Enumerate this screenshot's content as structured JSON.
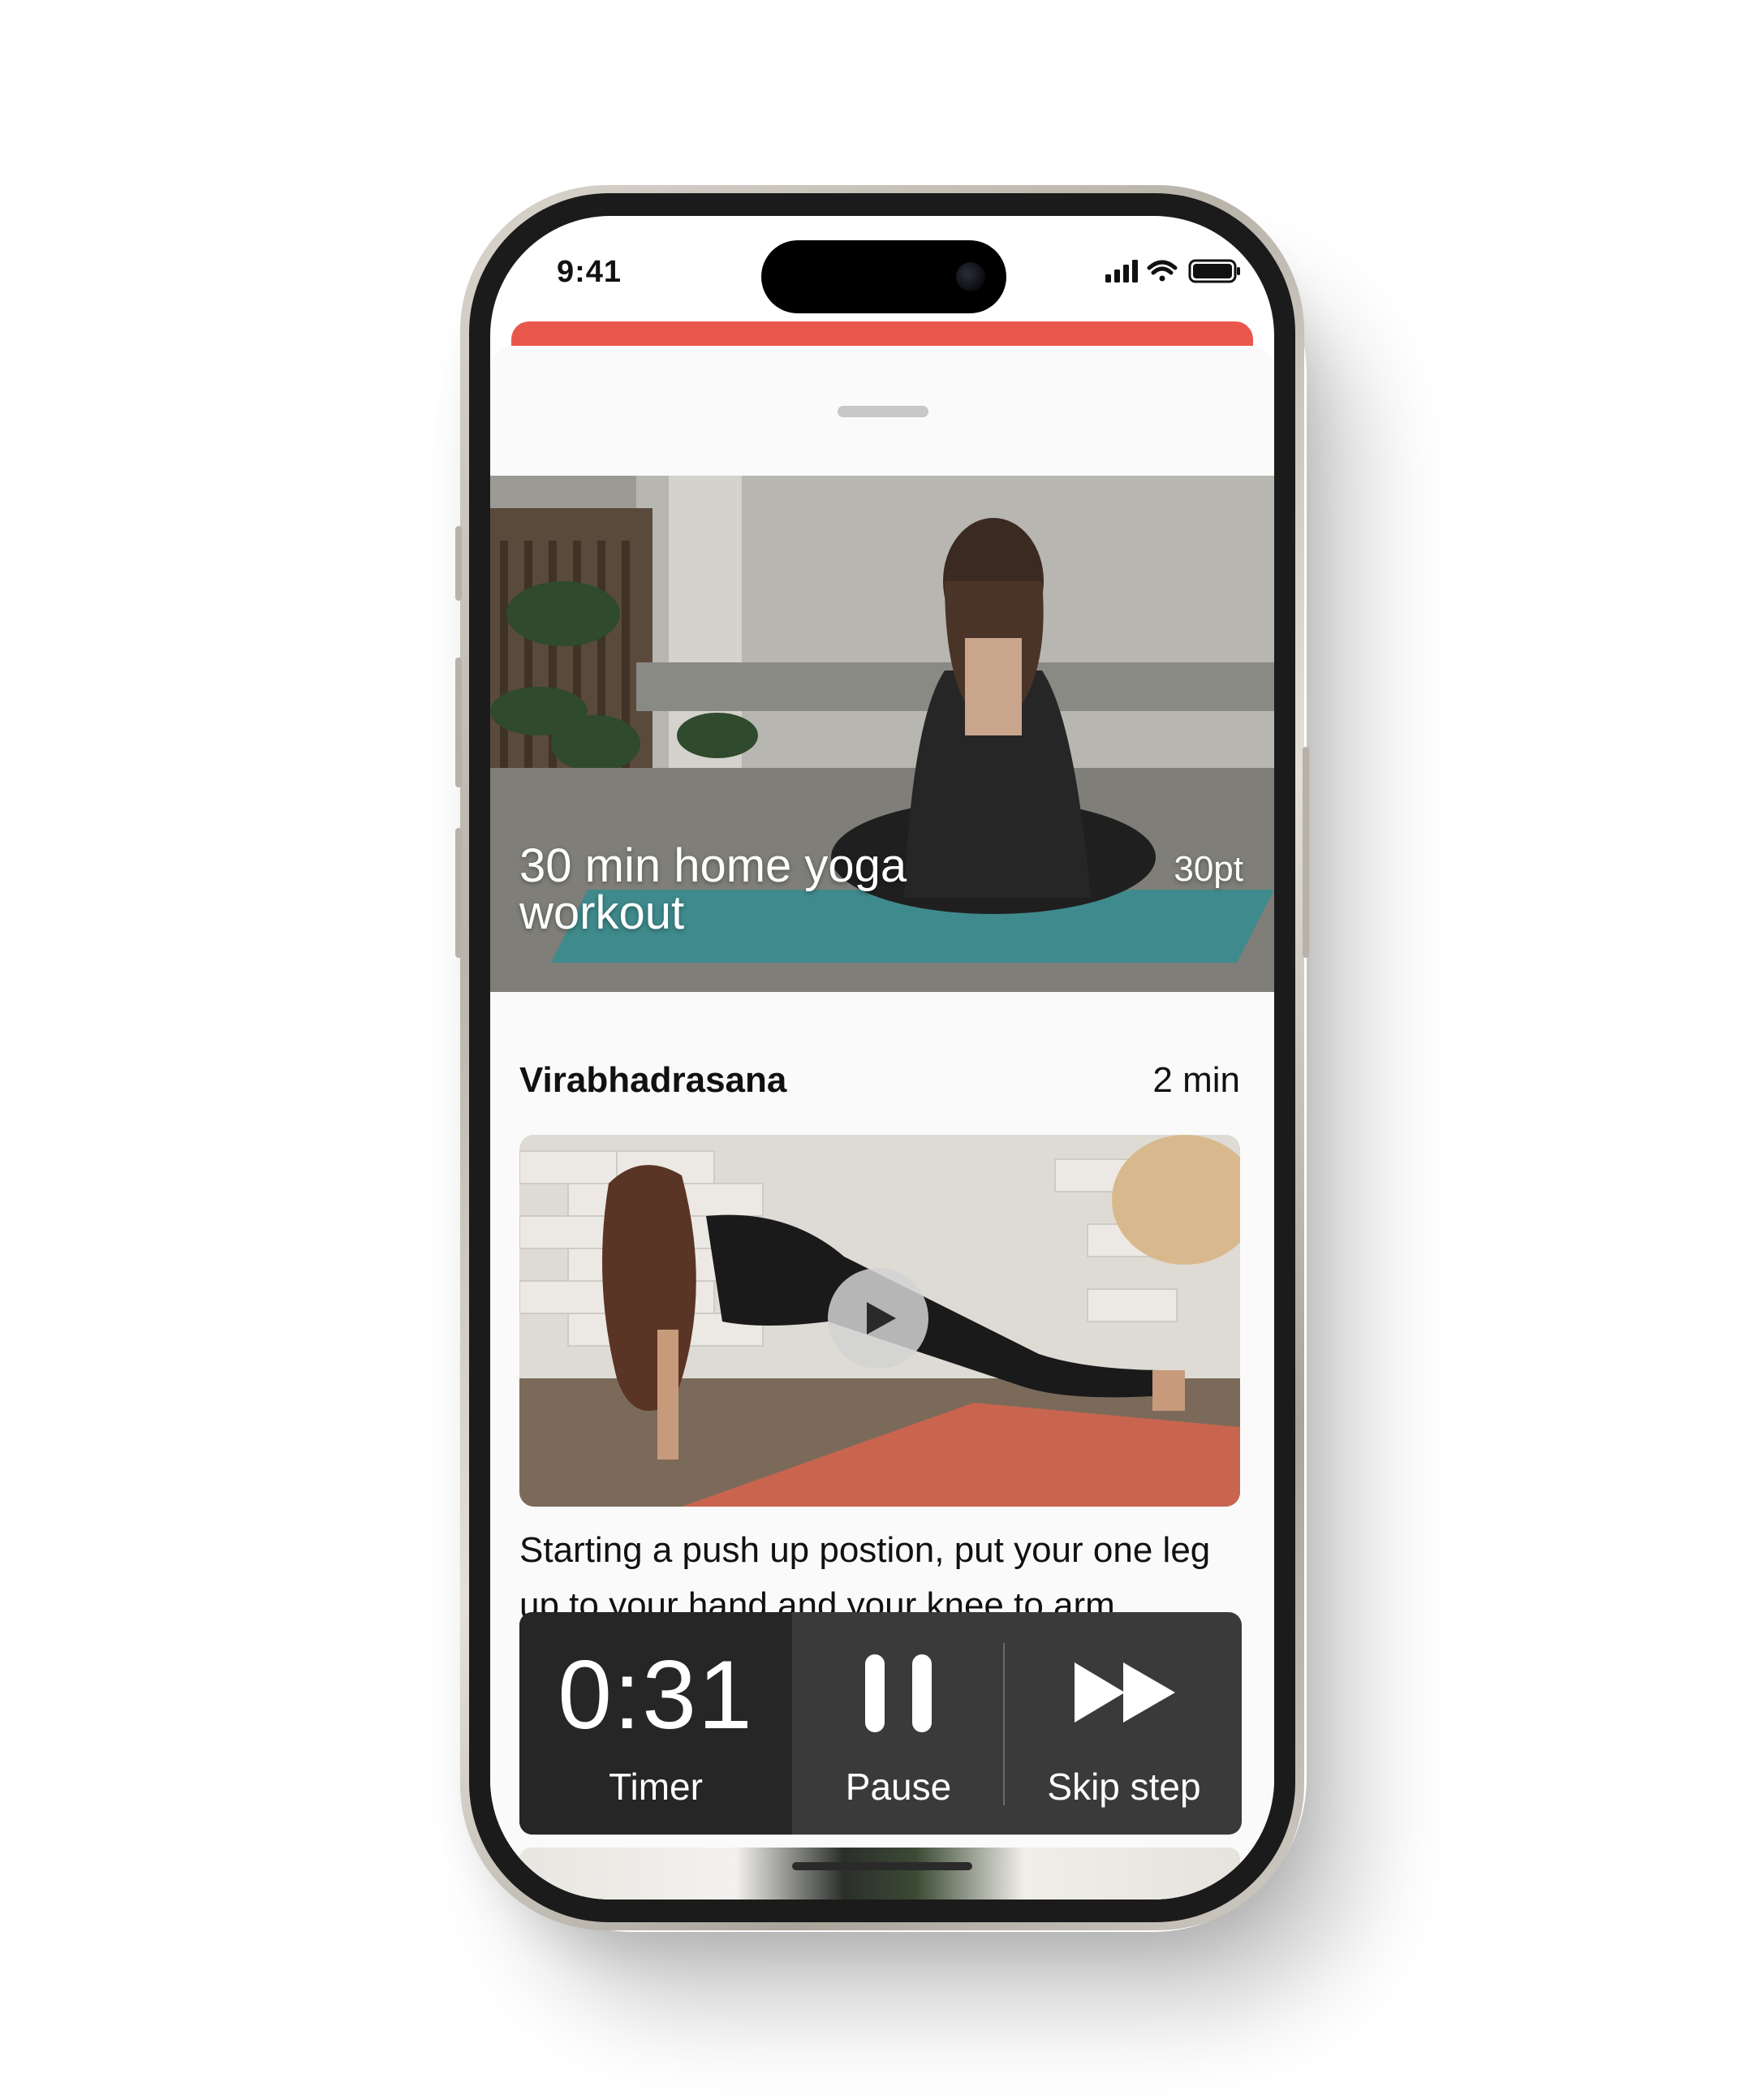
{
  "status_bar": {
    "time": "9:41",
    "icons": [
      "cellular-signal-icon",
      "wifi-icon",
      "battery-icon"
    ]
  },
  "workout": {
    "title": "30 min home yoga workout",
    "points": "30pt"
  },
  "step": {
    "name": "Virabhadrasana",
    "duration": "2 min",
    "instructions": "Starting a push up postion, put your one leg up to your hand and your knee to arm."
  },
  "controls": {
    "timer_value": "0:31",
    "timer_label": "Timer",
    "pause_label": "Pause",
    "skip_label": "Skip step"
  },
  "colors": {
    "accent_red": "#e9574c",
    "control_dark": "#262626",
    "control_gray": "#3a3a3a",
    "sheet_background": "#fafafa"
  }
}
